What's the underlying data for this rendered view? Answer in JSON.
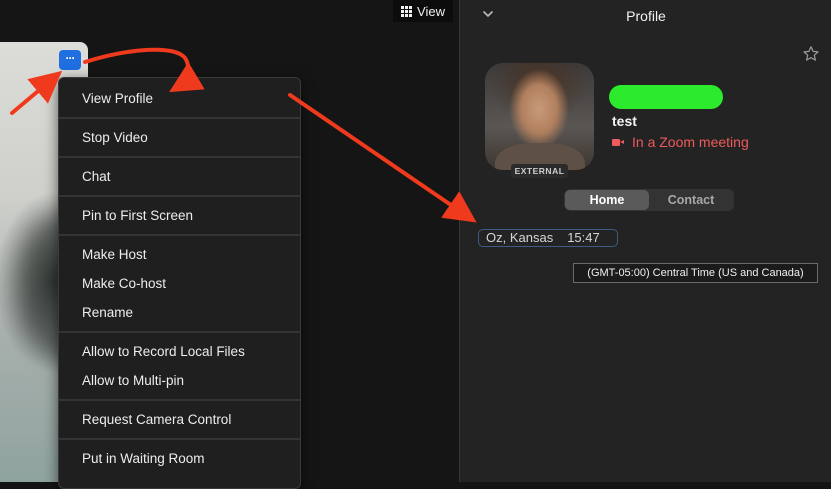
{
  "toolbar": {
    "view_label": "View",
    "view_icon": "grid-icon",
    "more_label": "···",
    "more_icon": "more-options-icon"
  },
  "context_menu": {
    "items": [
      "View Profile",
      "Stop Video",
      "Chat",
      "Pin to First Screen",
      "Make Host",
      "Make Co-host",
      "Rename",
      "Allow to Record Local Files",
      "Allow to Multi-pin",
      "Request Camera Control",
      "Put in Waiting Room"
    ]
  },
  "profile": {
    "title": "Profile",
    "badge": "EXTERNAL",
    "name_redaction_color": "#2cea2c",
    "username": "test",
    "status": "In a Zoom meeting",
    "status_color": "#ef5a5a",
    "tabs": [
      {
        "label": "Home",
        "active": true
      },
      {
        "label": "Contact",
        "active": false
      }
    ],
    "location": "Oz, Kansas",
    "local_time": "15:47",
    "timezone_tooltip": "(GMT-05:00) Central Time (US and Canada)"
  },
  "annotations": {
    "arrow_color": "#f03a1e"
  }
}
